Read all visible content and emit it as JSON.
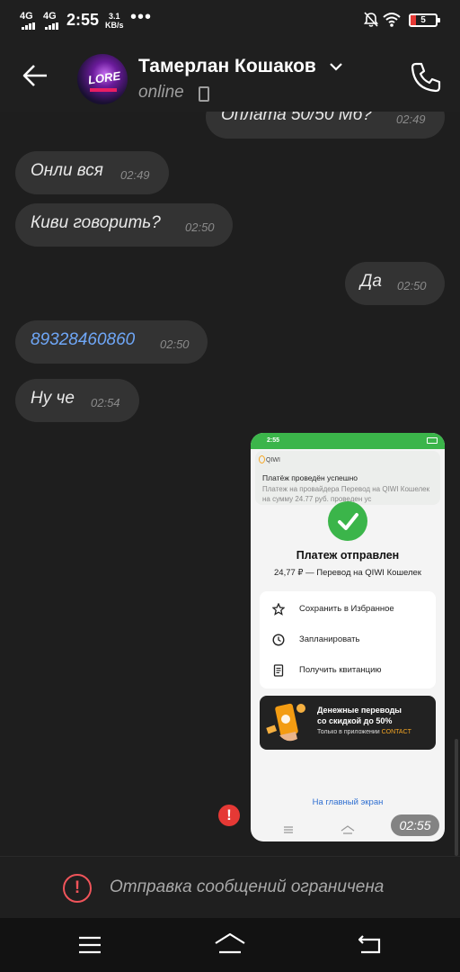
{
  "status_bar": {
    "signal1": "4G",
    "signal2": "4G",
    "time": "2:55",
    "speed_value": "3.1",
    "speed_unit": "KB/s",
    "more": "•••",
    "battery": "5",
    "icons": [
      "mute-icon",
      "wifi-icon",
      "battery-icon"
    ]
  },
  "header": {
    "contact_name": "Тамерлан Кошаков",
    "status": "online",
    "avatar_text": "LORE",
    "icons": [
      "back-arrow-icon",
      "chevron-down-icon",
      "device-icon",
      "phone-icon"
    ]
  },
  "messages": [
    {
      "side": "out",
      "text": "Оплата 50/50 Мб?",
      "time": "02:49"
    },
    {
      "side": "in",
      "text": "Онли вся",
      "time": "02:49"
    },
    {
      "side": "in",
      "text": "Киви говорить?",
      "time": "02:50"
    },
    {
      "side": "out",
      "text": "Да",
      "time": "02:50"
    },
    {
      "side": "in",
      "text": "89328460860",
      "time": "02:50",
      "is_link": true
    },
    {
      "side": "in",
      "text": "Ну че",
      "time": "02:54"
    }
  ],
  "image_message": {
    "time": "02:55",
    "status_time": "2:55",
    "notification": {
      "app": "QIWI",
      "title": "Платёж проведён успешно",
      "body": "Платеж на провайдера Перевод на QIWI Кошелек на сумму 24.77 руб. проведен ус"
    },
    "title": "Платеж отправлен",
    "subtitle": "24,77 ₽ — Перевод на QIWI Кошелек",
    "actions": [
      {
        "label": "Сохранить в Избранное",
        "icon": "star-icon"
      },
      {
        "label": "Запланировать",
        "icon": "clock-icon"
      },
      {
        "label": "Получить квитанцию",
        "icon": "receipt-icon"
      }
    ],
    "promo": {
      "line1": "Денежные переводы",
      "line2": "со скидкой до 50%",
      "line3_prefix": "Только в приложении ",
      "line3_accent": "CONTACT"
    },
    "home_link": "На главный экран",
    "error_badge": "!"
  },
  "composer": {
    "restriction_text": "Отправка сообщений ограничена",
    "icon": "warning-icon"
  },
  "nav_bar": {
    "icons": [
      "menu-icon",
      "home-icon",
      "back-icon"
    ]
  },
  "colors": {
    "background": "#1e1e1e",
    "bubble": "#333333",
    "link": "#6fa7f7",
    "error": "#e53935",
    "qiwi_green": "#3bb54a"
  }
}
